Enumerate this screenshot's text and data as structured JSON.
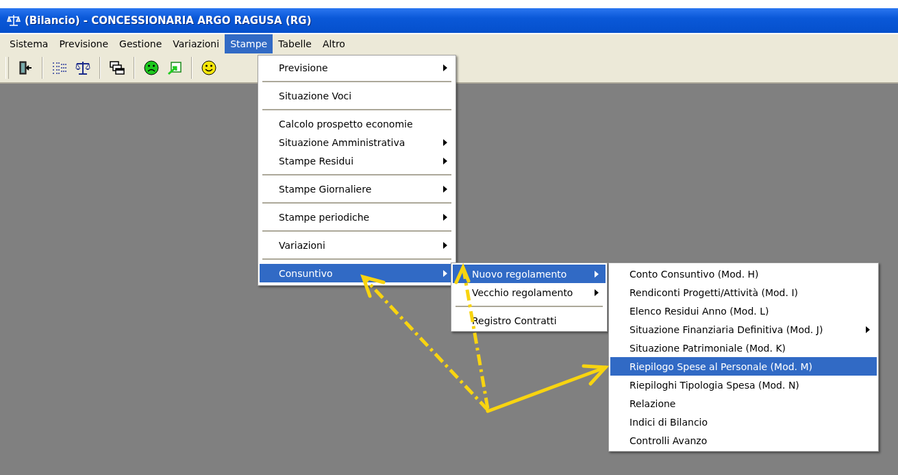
{
  "window": {
    "title": "(Bilancio) - CONCESSIONARIA ARGO RAGUSA (RG)"
  },
  "menu_bar": [
    {
      "label": "Sistema",
      "selected": false
    },
    {
      "label": "Previsione",
      "selected": false
    },
    {
      "label": "Gestione",
      "selected": false
    },
    {
      "label": "Variazioni",
      "selected": false
    },
    {
      "label": "Stampe",
      "selected": true
    },
    {
      "label": "Tabelle",
      "selected": false
    },
    {
      "label": "Altro",
      "selected": false
    }
  ],
  "menus": [
    {
      "items": [
        {
          "kind": "item",
          "label": "Previsione",
          "submenu": true,
          "selected": false
        },
        {
          "kind": "separator"
        },
        {
          "kind": "item",
          "label": "Situazione Voci",
          "submenu": false,
          "selected": false
        },
        {
          "kind": "separator"
        },
        {
          "kind": "item",
          "label": "Calcolo prospetto economie",
          "submenu": false,
          "selected": false
        },
        {
          "kind": "item",
          "label": "Situazione Amministrativa",
          "submenu": true,
          "selected": false
        },
        {
          "kind": "item",
          "label": "Stampe Residui",
          "submenu": true,
          "selected": false
        },
        {
          "kind": "separator"
        },
        {
          "kind": "item",
          "label": "Stampe Giornaliere",
          "submenu": true,
          "selected": false
        },
        {
          "kind": "separator"
        },
        {
          "kind": "item",
          "label": "Stampe periodiche",
          "submenu": true,
          "selected": false
        },
        {
          "kind": "separator"
        },
        {
          "kind": "item",
          "label": "Variazioni",
          "submenu": true,
          "selected": false
        },
        {
          "kind": "separator"
        },
        {
          "kind": "item",
          "label": "Consuntivo",
          "submenu": true,
          "selected": true
        }
      ]
    },
    {
      "items": [
        {
          "kind": "item",
          "label": "Nuovo regolamento",
          "submenu": true,
          "selected": true
        },
        {
          "kind": "item",
          "label": "Vecchio regolamento",
          "submenu": true,
          "selected": false
        },
        {
          "kind": "separator"
        },
        {
          "kind": "item",
          "label": "Registro Contratti",
          "submenu": false,
          "selected": false
        }
      ]
    },
    {
      "items": [
        {
          "kind": "item",
          "label": "Conto Consuntivo (Mod. H)",
          "submenu": false,
          "selected": false
        },
        {
          "kind": "item",
          "label": "Rendiconti Progetti/Attività (Mod. I)",
          "submenu": false,
          "selected": false
        },
        {
          "kind": "item",
          "label": "Elenco Residui Anno (Mod. L)",
          "submenu": false,
          "selected": false
        },
        {
          "kind": "item",
          "label": "Situazione Finanziaria Definitiva (Mod. J)",
          "submenu": true,
          "selected": false
        },
        {
          "kind": "item",
          "label": "Situazione Patrimoniale (Mod. K)",
          "submenu": false,
          "selected": false
        },
        {
          "kind": "item",
          "label": "Riepilogo Spese al Personale (Mod. M)",
          "submenu": false,
          "selected": true
        },
        {
          "kind": "item",
          "label": "Riepiloghi Tipologia Spesa (Mod. N)",
          "submenu": false,
          "selected": false
        },
        {
          "kind": "item",
          "label": "Relazione",
          "submenu": false,
          "selected": false
        },
        {
          "kind": "item",
          "label": "Indici di Bilancio",
          "submenu": false,
          "selected": false
        },
        {
          "kind": "item",
          "label": "Controlli Avanzo",
          "submenu": false,
          "selected": false
        }
      ]
    }
  ]
}
